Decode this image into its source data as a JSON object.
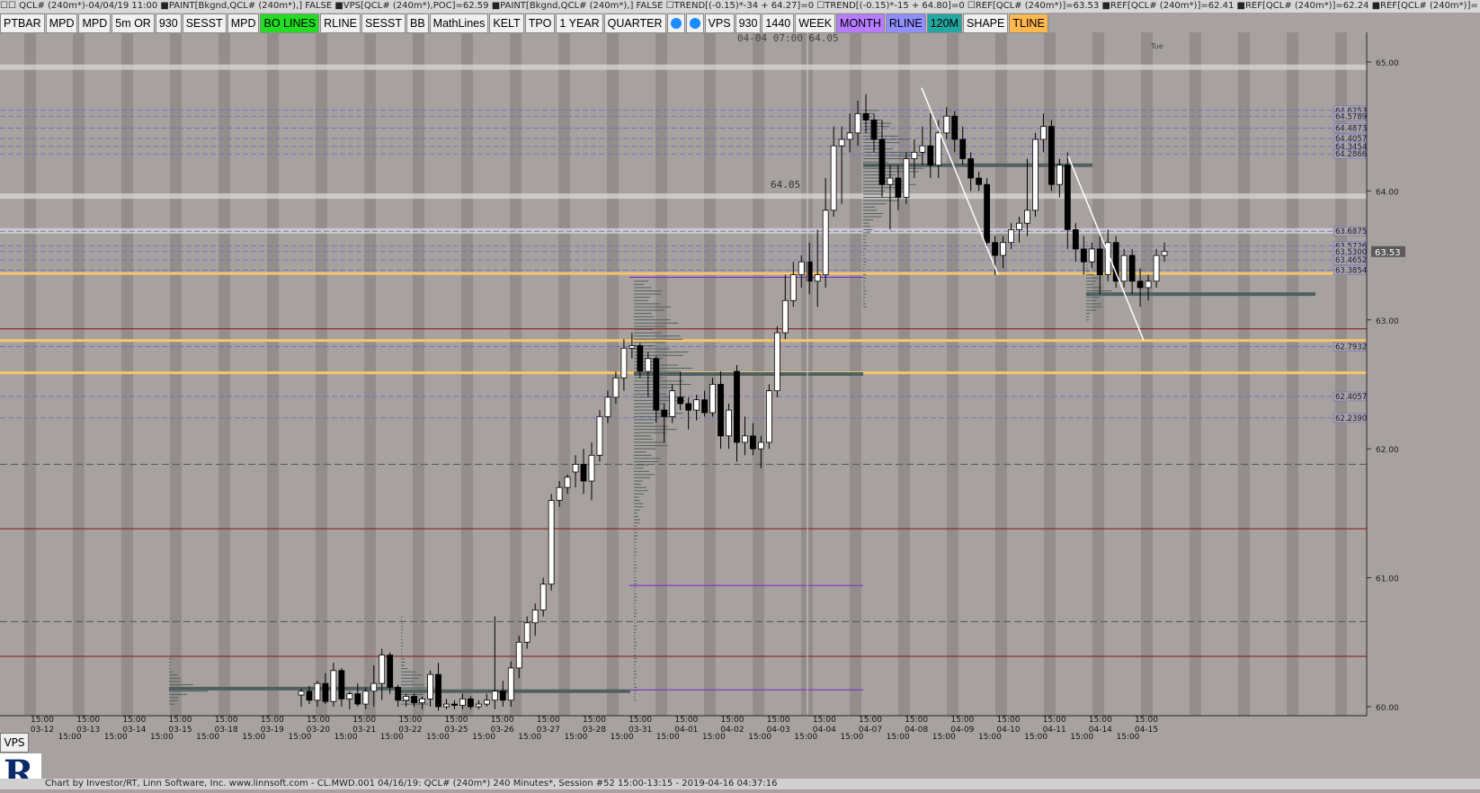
{
  "header": {
    "title": "☐☐ QCL# (240m*)-04/04/19 11:00 ■PAINT[Bkgnd,QCL# (240m*),] FALSE ■VPS[QCL# (240m*),POC]=62.59 ■PAINT[Bkgnd,QCL# (240m*),] FALSE ☐TREND[(-0.15)*-34 + 64.27]=0 ☐TREND[(-0.15)*-15 + 64.80]=0 ☐REF[QCL# (240m*)]=63.53 ■REF[QCL# (240m*)]=62.41 ■REF[QCL# (240m*)]=62.24 ■REF[QCL# (240m*)]="
  },
  "toolbar": [
    {
      "label": "PTBAR",
      "bg": "#f0f0f0"
    },
    {
      "label": "MPD",
      "bg": "#f0f0f0"
    },
    {
      "label": "MPD",
      "bg": "#f0f0f0"
    },
    {
      "label": "5m OR",
      "bg": "#f0f0f0"
    },
    {
      "label": "930",
      "bg": "#f0f0f0"
    },
    {
      "label": "SESST",
      "bg": "#f0f0f0"
    },
    {
      "label": "MPD",
      "bg": "#f0f0f0"
    },
    {
      "label": "BO LINES",
      "bg": "#22dd22"
    },
    {
      "label": "RLINE",
      "bg": "#f0f0f0"
    },
    {
      "label": "SESST",
      "bg": "#f0f0f0"
    },
    {
      "label": "BB",
      "bg": "#f0f0f0"
    },
    {
      "label": "MathLines",
      "bg": "#f0f0f0"
    },
    {
      "label": "KELT",
      "bg": "#f0f0f0"
    },
    {
      "label": "TPO",
      "bg": "#f0f0f0"
    },
    {
      "label": "1 YEAR",
      "bg": "#f0f0f0"
    },
    {
      "label": "QUARTER",
      "bg": "#f0f0f0"
    },
    {
      "label": "",
      "bg": "#f0f0f0",
      "icon": "drop-icon"
    },
    {
      "label": "",
      "bg": "#f0f0f0",
      "icon": "clock-icon"
    },
    {
      "label": "VPS",
      "bg": "#f0f0f0"
    },
    {
      "label": "930",
      "bg": "#f0f0f0"
    },
    {
      "label": "1440",
      "bg": "#f0f0f0"
    },
    {
      "label": "WEEK",
      "bg": "#f0f0f0"
    },
    {
      "label": "MONTH",
      "bg": "#b77cff"
    },
    {
      "label": "RLINE",
      "bg": "#8f8fff"
    },
    {
      "label": "120M",
      "bg": "#22a8a0"
    },
    {
      "label": "SHAPE",
      "bg": "#f0f0f0"
    },
    {
      "label": "TLINE",
      "bg": "#ffb84d"
    }
  ],
  "vps_label": "VPS",
  "footer": {
    "text": "Chart by Investor/RT, Linn Software, Inc. www.linnsoft.com - CL.MWD.001   04/16/19: QCL# (240m*) 240 Minutes*, Session #52 15:00-13:15 - 2019-04-16 04:37:16"
  },
  "chart_data": {
    "type": "candlestick",
    "ylim": [
      59.93,
      65.23
    ],
    "yticks": [
      "65.00",
      "64.00",
      "63.00",
      "62.00",
      "61.00",
      "60.00"
    ],
    "last_price": "63.53",
    "right_edge_label": "Tue",
    "crosshair": {
      "label": "04-04 07:00",
      "value": "64.05",
      "chart_label": "64.05"
    },
    "ref_levels": [
      {
        "label": "64.6253",
        "value": 64.625
      },
      {
        "label": "64.5789",
        "value": 64.579
      },
      {
        "label": "64.4873",
        "value": 64.487
      },
      {
        "label": "64.4057",
        "value": 64.406
      },
      {
        "label": "64.3454",
        "value": 64.345
      },
      {
        "label": "64.2866",
        "value": 64.287
      },
      {
        "label": "63.6875",
        "value": 63.6875
      },
      {
        "label": "63.5726",
        "value": 63.573
      },
      {
        "label": "63.5300",
        "value": 63.53
      },
      {
        "label": "63.4652",
        "value": 63.465
      },
      {
        "label": "63.3854",
        "value": 63.385
      },
      {
        "label": "62.7932",
        "value": 62.793
      },
      {
        "label": "62.4057",
        "value": 62.406
      },
      {
        "label": "62.2390",
        "value": 62.239
      }
    ],
    "session_labels": [
      {
        "time": "15:00",
        "date": "03-12"
      },
      {
        "time": "15:00",
        "date": "03-13"
      },
      {
        "time": "15:00",
        "date": "03-14"
      },
      {
        "time": "15:00",
        "date": "03-15"
      },
      {
        "time": "15:00",
        "date": "03-18"
      },
      {
        "time": "15:00",
        "date": "03-19"
      },
      {
        "time": "15:00",
        "date": "03-20"
      },
      {
        "time": "15:00",
        "date": "03-21"
      },
      {
        "time": "15:00",
        "date": "03-22"
      },
      {
        "time": "15:00",
        "date": "03-25"
      },
      {
        "time": "15:00",
        "date": "03-26"
      },
      {
        "time": "15:00",
        "date": "03-27"
      },
      {
        "time": "15:00",
        "date": "03-28"
      },
      {
        "time": "15:00",
        "date": "03-31"
      },
      {
        "time": "15:00",
        "date": "04-01"
      },
      {
        "time": "15:00",
        "date": "04-02"
      },
      {
        "time": "15:00",
        "date": "04-03"
      },
      {
        "time": "15:00",
        "date": "04-04"
      },
      {
        "time": "15:00",
        "date": "04-07"
      },
      {
        "time": "15:00",
        "date": "04-08"
      },
      {
        "time": "15:00",
        "date": "04-09"
      },
      {
        "time": "15:00",
        "date": "04-10"
      },
      {
        "time": "15:00",
        "date": "04-11"
      },
      {
        "time": "15:00",
        "date": "04-14"
      },
      {
        "time": "15:00",
        "date": "04-15"
      }
    ],
    "candles": [
      {
        "o": 60.09,
        "h": 60.14,
        "l": 60.0,
        "c": 60.12
      },
      {
        "o": 60.12,
        "h": 60.16,
        "l": 60.02,
        "c": 60.05
      },
      {
        "o": 60.05,
        "h": 60.2,
        "l": 60.0,
        "c": 60.18
      },
      {
        "o": 60.18,
        "h": 60.26,
        "l": 60.02,
        "c": 60.04
      },
      {
        "o": 60.04,
        "h": 60.34,
        "l": 60.0,
        "c": 60.28
      },
      {
        "o": 60.28,
        "h": 60.3,
        "l": 60.0,
        "c": 60.06
      },
      {
        "o": 60.06,
        "h": 60.12,
        "l": 59.98,
        "c": 60.1
      },
      {
        "o": 60.1,
        "h": 60.18,
        "l": 60.0,
        "c": 60.02
      },
      {
        "o": 60.02,
        "h": 60.15,
        "l": 59.98,
        "c": 60.12
      },
      {
        "o": 60.12,
        "h": 60.32,
        "l": 60.0,
        "c": 60.18
      },
      {
        "o": 60.18,
        "h": 60.45,
        "l": 60.05,
        "c": 60.4
      },
      {
        "o": 60.4,
        "h": 60.42,
        "l": 60.1,
        "c": 60.15
      },
      {
        "o": 60.15,
        "h": 60.17,
        "l": 60.0,
        "c": 60.05
      },
      {
        "o": 60.05,
        "h": 60.1,
        "l": 60.0,
        "c": 60.08
      },
      {
        "o": 60.08,
        "h": 60.1,
        "l": 60.0,
        "c": 60.03
      },
      {
        "o": 60.03,
        "h": 60.08,
        "l": 59.98,
        "c": 60.06
      },
      {
        "o": 60.06,
        "h": 60.28,
        "l": 60.0,
        "c": 60.25
      },
      {
        "o": 60.25,
        "h": 60.34,
        "l": 59.97,
        "c": 60.0
      },
      {
        "o": 60.0,
        "h": 60.06,
        "l": 59.98,
        "c": 60.02
      },
      {
        "o": 60.02,
        "h": 60.05,
        "l": 59.98,
        "c": 60.01
      },
      {
        "o": 60.01,
        "h": 60.1,
        "l": 59.98,
        "c": 60.06
      },
      {
        "o": 60.06,
        "h": 60.08,
        "l": 59.98,
        "c": 60.0
      },
      {
        "o": 60.0,
        "h": 60.05,
        "l": 59.98,
        "c": 60.02
      },
      {
        "o": 60.02,
        "h": 60.1,
        "l": 60.0,
        "c": 60.05
      },
      {
        "o": 60.05,
        "h": 60.7,
        "l": 59.98,
        "c": 60.12
      },
      {
        "o": 60.12,
        "h": 60.2,
        "l": 60.0,
        "c": 60.05
      },
      {
        "o": 60.05,
        "h": 60.35,
        "l": 60.0,
        "c": 60.3
      },
      {
        "o": 60.3,
        "h": 60.55,
        "l": 60.22,
        "c": 60.5
      },
      {
        "o": 60.5,
        "h": 60.7,
        "l": 60.45,
        "c": 60.65
      },
      {
        "o": 60.65,
        "h": 60.8,
        "l": 60.55,
        "c": 60.75
      },
      {
        "o": 60.75,
        "h": 61.0,
        "l": 60.7,
        "c": 60.95
      },
      {
        "o": 60.95,
        "h": 61.65,
        "l": 60.9,
        "c": 61.6
      },
      {
        "o": 61.6,
        "h": 61.75,
        "l": 61.55,
        "c": 61.7
      },
      {
        "o": 61.7,
        "h": 61.8,
        "l": 61.65,
        "c": 61.78
      },
      {
        "o": 61.82,
        "h": 61.95,
        "l": 61.7,
        "c": 61.88
      },
      {
        "o": 61.88,
        "h": 62.0,
        "l": 61.65,
        "c": 61.75
      },
      {
        "o": 61.75,
        "h": 62.05,
        "l": 61.6,
        "c": 61.95
      },
      {
        "o": 61.95,
        "h": 62.3,
        "l": 61.9,
        "c": 62.25
      },
      {
        "o": 62.25,
        "h": 62.45,
        "l": 62.2,
        "c": 62.4
      },
      {
        "o": 62.4,
        "h": 62.6,
        "l": 62.35,
        "c": 62.55
      },
      {
        "o": 62.55,
        "h": 62.85,
        "l": 62.45,
        "c": 62.78
      },
      {
        "o": 62.78,
        "h": 62.9,
        "l": 62.7,
        "c": 62.8
      },
      {
        "o": 62.8,
        "h": 62.82,
        "l": 62.55,
        "c": 62.6
      },
      {
        "o": 62.6,
        "h": 62.75,
        "l": 62.4,
        "c": 62.7
      },
      {
        "o": 62.7,
        "h": 62.72,
        "l": 62.2,
        "c": 62.3
      },
      {
        "o": 62.3,
        "h": 62.35,
        "l": 62.05,
        "c": 62.25
      },
      {
        "o": 62.25,
        "h": 62.5,
        "l": 62.2,
        "c": 62.45
      },
      {
        "o": 62.4,
        "h": 62.6,
        "l": 62.3,
        "c": 62.35
      },
      {
        "o": 62.35,
        "h": 62.4,
        "l": 62.15,
        "c": 62.3
      },
      {
        "o": 62.3,
        "h": 62.42,
        "l": 62.22,
        "c": 62.38
      },
      {
        "o": 62.38,
        "h": 62.45,
        "l": 62.25,
        "c": 62.28
      },
      {
        "o": 62.28,
        "h": 62.55,
        "l": 62.25,
        "c": 62.5
      },
      {
        "o": 62.5,
        "h": 62.6,
        "l": 62.0,
        "c": 62.1
      },
      {
        "o": 62.1,
        "h": 62.35,
        "l": 62.0,
        "c": 62.3
      },
      {
        "o": 62.6,
        "h": 62.65,
        "l": 61.9,
        "c": 62.05
      },
      {
        "o": 62.05,
        "h": 62.25,
        "l": 61.95,
        "c": 62.1
      },
      {
        "o": 62.1,
        "h": 62.2,
        "l": 61.95,
        "c": 62.0
      },
      {
        "o": 62.0,
        "h": 62.1,
        "l": 61.85,
        "c": 62.05
      },
      {
        "o": 62.05,
        "h": 62.5,
        "l": 62.0,
        "c": 62.45
      },
      {
        "o": 62.45,
        "h": 62.95,
        "l": 62.4,
        "c": 62.9
      },
      {
        "o": 62.9,
        "h": 63.35,
        "l": 62.85,
        "c": 63.15
      },
      {
        "o": 63.15,
        "h": 63.45,
        "l": 63.1,
        "c": 63.35
      },
      {
        "o": 63.35,
        "h": 63.5,
        "l": 63.25,
        "c": 63.45
      },
      {
        "o": 63.45,
        "h": 63.6,
        "l": 63.2,
        "c": 63.3
      },
      {
        "o": 63.3,
        "h": 63.7,
        "l": 63.1,
        "c": 63.35
      },
      {
        "o": 63.35,
        "h": 64.1,
        "l": 63.25,
        "c": 63.85
      },
      {
        "o": 63.85,
        "h": 64.5,
        "l": 63.8,
        "c": 64.35
      },
      {
        "o": 64.35,
        "h": 64.5,
        "l": 63.9,
        "c": 64.4
      },
      {
        "o": 64.4,
        "h": 64.6,
        "l": 64.3,
        "c": 64.45
      },
      {
        "o": 64.45,
        "h": 64.7,
        "l": 64.35,
        "c": 64.6
      },
      {
        "o": 64.6,
        "h": 64.75,
        "l": 64.45,
        "c": 64.55
      },
      {
        "o": 64.55,
        "h": 64.6,
        "l": 64.3,
        "c": 64.4
      },
      {
        "o": 64.4,
        "h": 64.55,
        "l": 63.95,
        "c": 64.05
      },
      {
        "o": 64.05,
        "h": 64.2,
        "l": 63.7,
        "c": 64.1
      },
      {
        "o": 64.1,
        "h": 64.2,
        "l": 63.85,
        "c": 63.95
      },
      {
        "o": 63.95,
        "h": 64.3,
        "l": 63.9,
        "c": 64.25
      },
      {
        "o": 64.25,
        "h": 64.4,
        "l": 64.1,
        "c": 64.3
      },
      {
        "o": 64.3,
        "h": 64.5,
        "l": 64.2,
        "c": 64.35
      },
      {
        "o": 64.35,
        "h": 64.6,
        "l": 64.1,
        "c": 64.2
      },
      {
        "o": 64.2,
        "h": 64.55,
        "l": 64.1,
        "c": 64.45
      },
      {
        "o": 64.45,
        "h": 64.65,
        "l": 64.4,
        "c": 64.58
      },
      {
        "o": 64.58,
        "h": 64.62,
        "l": 64.3,
        "c": 64.4
      },
      {
        "o": 64.4,
        "h": 64.5,
        "l": 64.2,
        "c": 64.25
      },
      {
        "o": 64.25,
        "h": 64.3,
        "l": 64.0,
        "c": 64.1
      },
      {
        "o": 64.1,
        "h": 64.15,
        "l": 64.0,
        "c": 64.05
      },
      {
        "o": 64.05,
        "h": 64.1,
        "l": 63.55,
        "c": 63.6
      },
      {
        "o": 63.6,
        "h": 63.65,
        "l": 63.35,
        "c": 63.5
      },
      {
        "o": 63.5,
        "h": 63.65,
        "l": 63.4,
        "c": 63.6
      },
      {
        "o": 63.6,
        "h": 63.75,
        "l": 63.55,
        "c": 63.7
      },
      {
        "o": 63.7,
        "h": 63.8,
        "l": 63.6,
        "c": 63.75
      },
      {
        "o": 63.75,
        "h": 64.25,
        "l": 63.65,
        "c": 63.85
      },
      {
        "o": 63.85,
        "h": 64.45,
        "l": 63.8,
        "c": 64.4
      },
      {
        "o": 64.4,
        "h": 64.6,
        "l": 64.3,
        "c": 64.5
      },
      {
        "o": 64.5,
        "h": 64.55,
        "l": 64.0,
        "c": 64.05
      },
      {
        "o": 64.05,
        "h": 64.25,
        "l": 63.95,
        "c": 64.2
      },
      {
        "o": 64.2,
        "h": 64.3,
        "l": 63.55,
        "c": 63.7
      },
      {
        "o": 63.7,
        "h": 63.75,
        "l": 63.45,
        "c": 63.55
      },
      {
        "o": 63.55,
        "h": 63.65,
        "l": 63.35,
        "c": 63.45
      },
      {
        "o": 63.45,
        "h": 63.6,
        "l": 63.4,
        "c": 63.55
      },
      {
        "o": 63.55,
        "h": 63.65,
        "l": 63.2,
        "c": 63.35
      },
      {
        "o": 63.35,
        "h": 63.7,
        "l": 63.3,
        "c": 63.6
      },
      {
        "o": 63.6,
        "h": 63.65,
        "l": 63.25,
        "c": 63.3
      },
      {
        "o": 63.3,
        "h": 63.55,
        "l": 63.25,
        "c": 63.5
      },
      {
        "o": 63.5,
        "h": 63.55,
        "l": 63.2,
        "c": 63.3
      },
      {
        "o": 63.3,
        "h": 63.4,
        "l": 63.1,
        "c": 63.25
      },
      {
        "o": 63.25,
        "h": 63.35,
        "l": 63.15,
        "c": 63.3
      },
      {
        "o": 63.3,
        "h": 63.55,
        "l": 63.25,
        "c": 63.5
      },
      {
        "o": 63.5,
        "h": 63.6,
        "l": 63.45,
        "c": 63.53
      }
    ]
  },
  "colors": {
    "background": "#a7a29f",
    "band": "#938e8b",
    "bull": "#ffffff",
    "bear": "#000000",
    "poc": "#f7c66a",
    "profile": "#506060",
    "ref_line": "#6a6ad0",
    "red_line": "#8b1010",
    "purple_line": "#8030d0",
    "trend_line": "#ffffff",
    "axis": "#2a2a2a"
  }
}
